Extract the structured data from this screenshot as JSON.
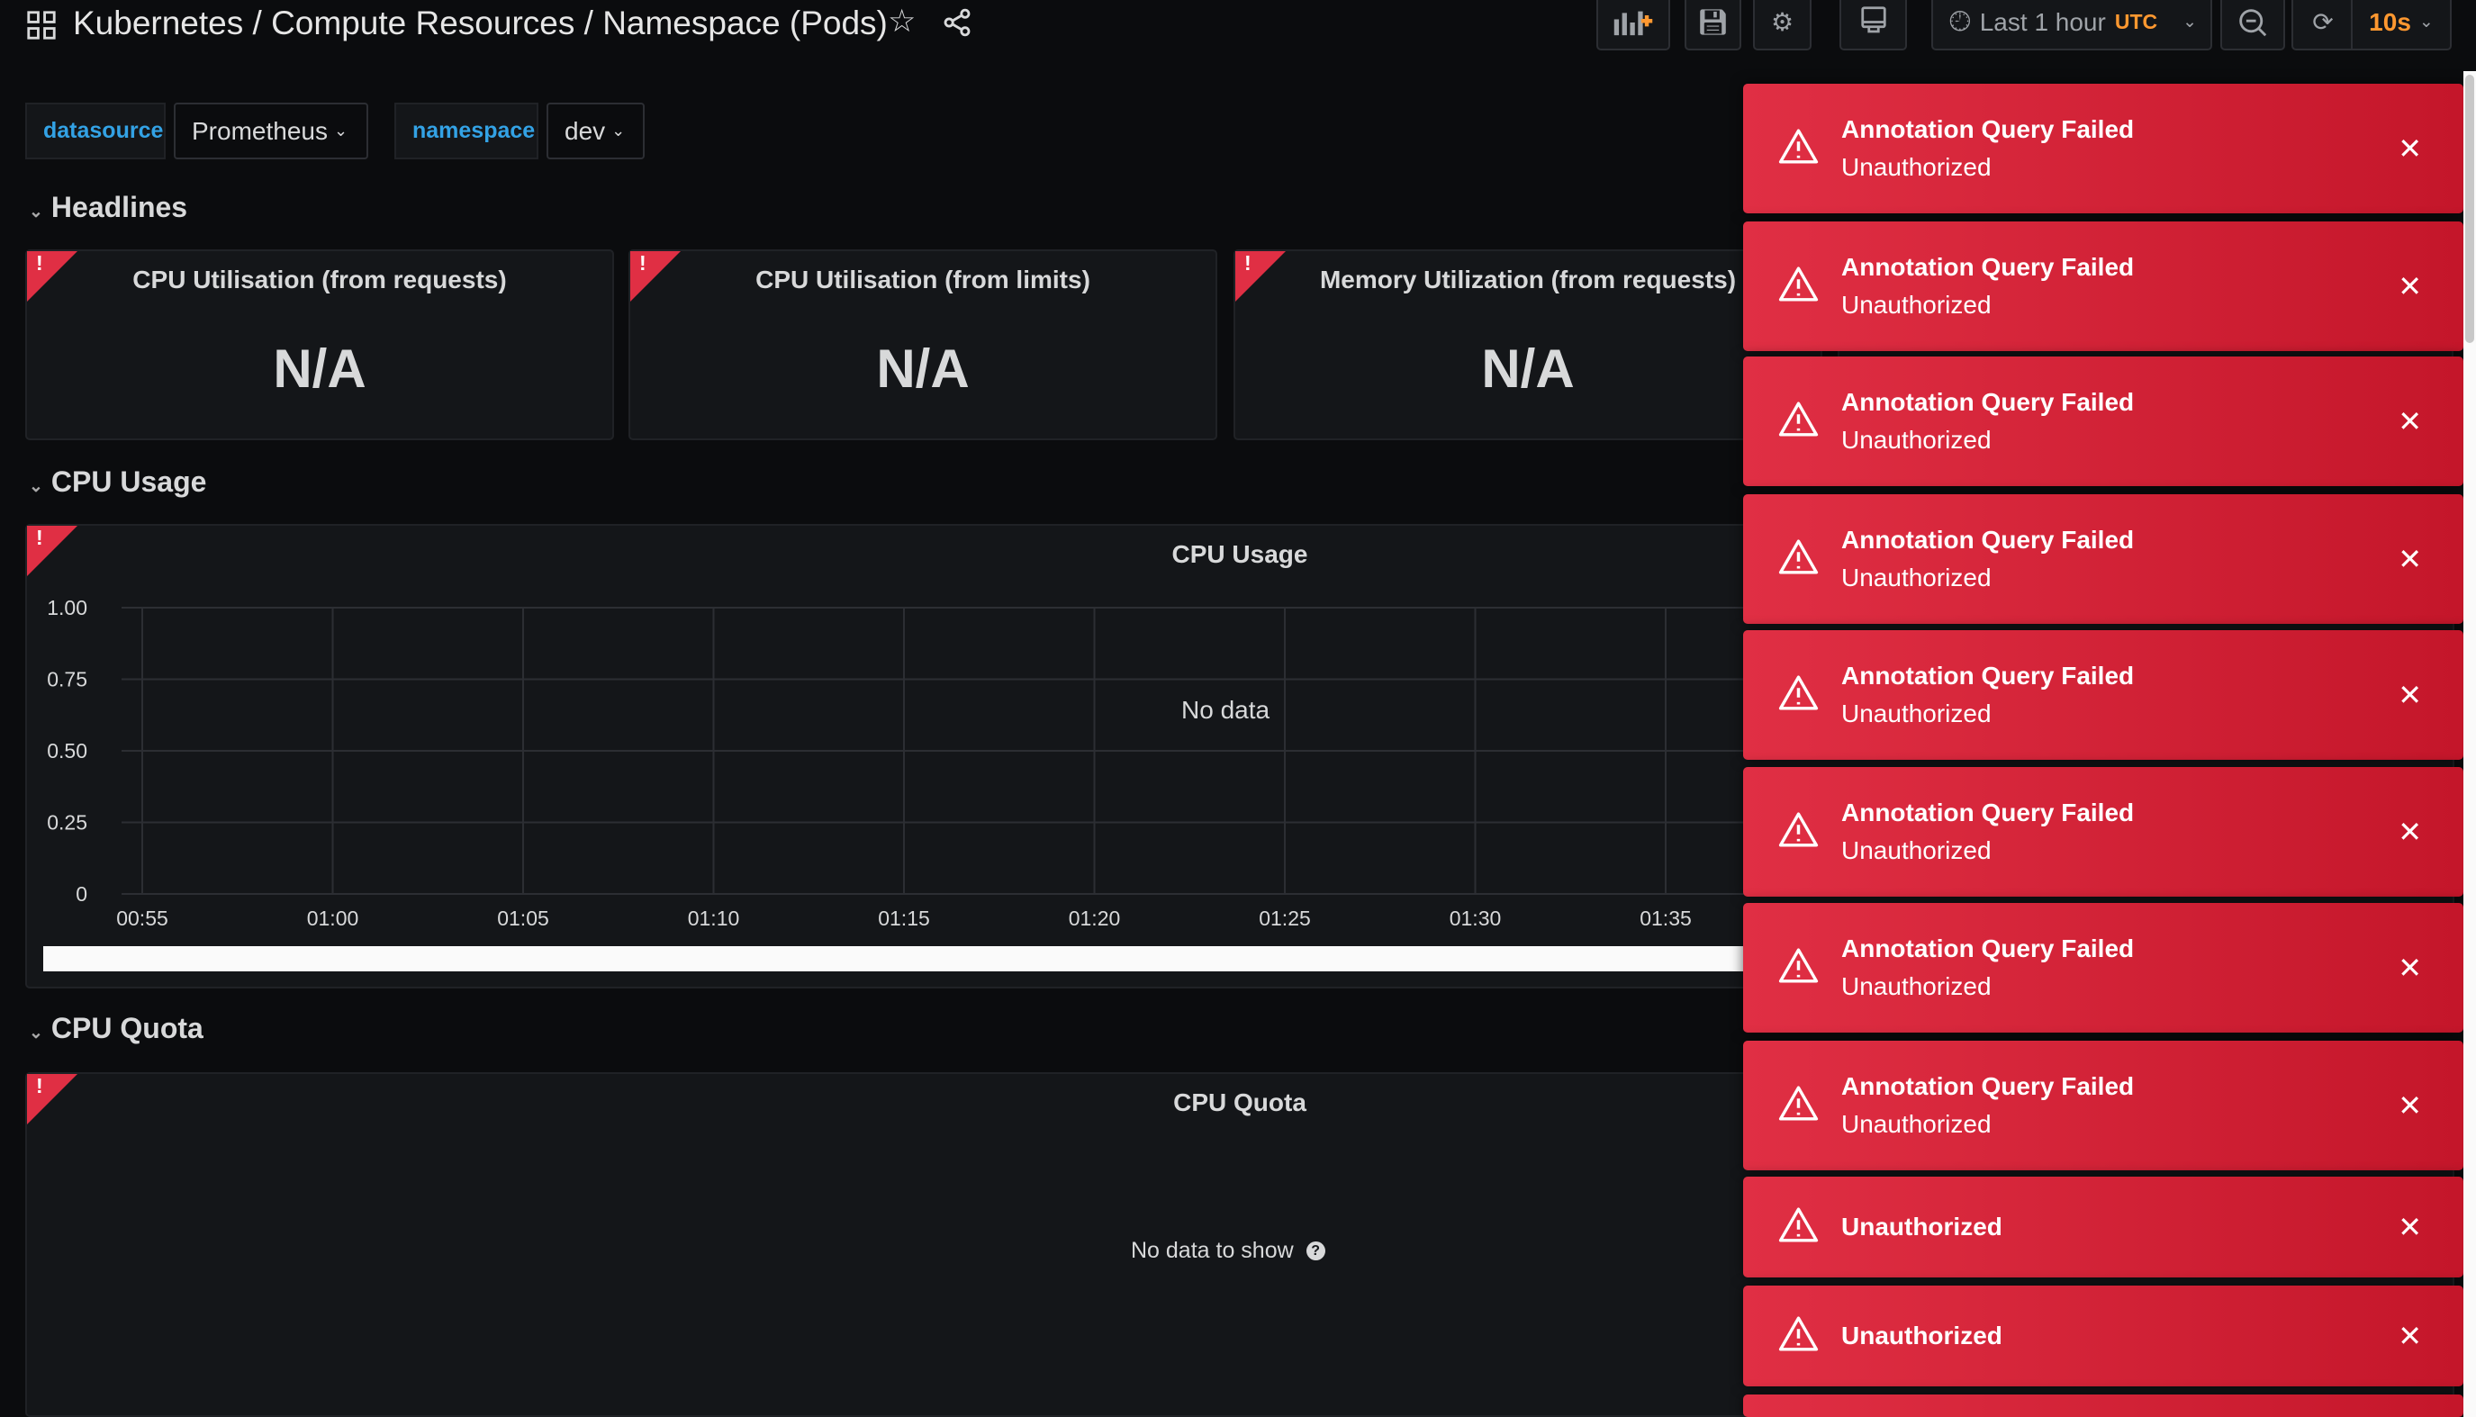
{
  "header": {
    "title": "Kubernetes / Compute Resources / Namespace (Pods)"
  },
  "toolbar": {
    "time_range": "Last 1 hour",
    "timezone": "UTC",
    "refresh_interval": "10s"
  },
  "variables": [
    {
      "label": "datasource",
      "value": "Prometheus"
    },
    {
      "label": "namespace",
      "value": "dev"
    }
  ],
  "rows": {
    "headlines": "Headlines",
    "cpu_usage": "CPU Usage",
    "cpu_quota": "CPU Quota"
  },
  "stats": [
    {
      "title": "CPU Utilisation (from requests)",
      "value": "N/A"
    },
    {
      "title": "CPU Utilisation (from limits)",
      "value": "N/A"
    },
    {
      "title": "Memory Utilization (from requests)",
      "value": "N/A"
    }
  ],
  "cpu_usage_panel": {
    "title": "CPU Usage",
    "no_data": "No data"
  },
  "cpu_quota_panel": {
    "title": "CPU Quota",
    "no_data": "No data to show"
  },
  "chart_data": {
    "type": "line",
    "title": "CPU Usage",
    "y_ticks": [
      "1.00",
      "0.75",
      "0.50",
      "0.25",
      "0"
    ],
    "x_ticks": [
      "00:55",
      "01:00",
      "01:05",
      "01:10",
      "01:15",
      "01:20",
      "01:25",
      "01:30",
      "01:35"
    ],
    "ylim": [
      0,
      1
    ],
    "grid": true,
    "series": []
  },
  "toasts": [
    {
      "title": "Annotation Query Failed",
      "text": "Unauthorized"
    },
    {
      "title": "Annotation Query Failed",
      "text": "Unauthorized"
    },
    {
      "title": "Annotation Query Failed",
      "text": "Unauthorized"
    },
    {
      "title": "Annotation Query Failed",
      "text": "Unauthorized"
    },
    {
      "title": "Annotation Query Failed",
      "text": "Unauthorized"
    },
    {
      "title": "Annotation Query Failed",
      "text": "Unauthorized"
    },
    {
      "title": "Annotation Query Failed",
      "text": "Unauthorized"
    },
    {
      "title": "Annotation Query Failed",
      "text": "Unauthorized"
    },
    {
      "title": "",
      "text": "Unauthorized"
    },
    {
      "title": "",
      "text": "Unauthorized"
    },
    {
      "title": "",
      "text": ""
    }
  ],
  "colors": {
    "error": "#e02f44",
    "accent": "#ff9830",
    "link": "#33a2e5"
  }
}
